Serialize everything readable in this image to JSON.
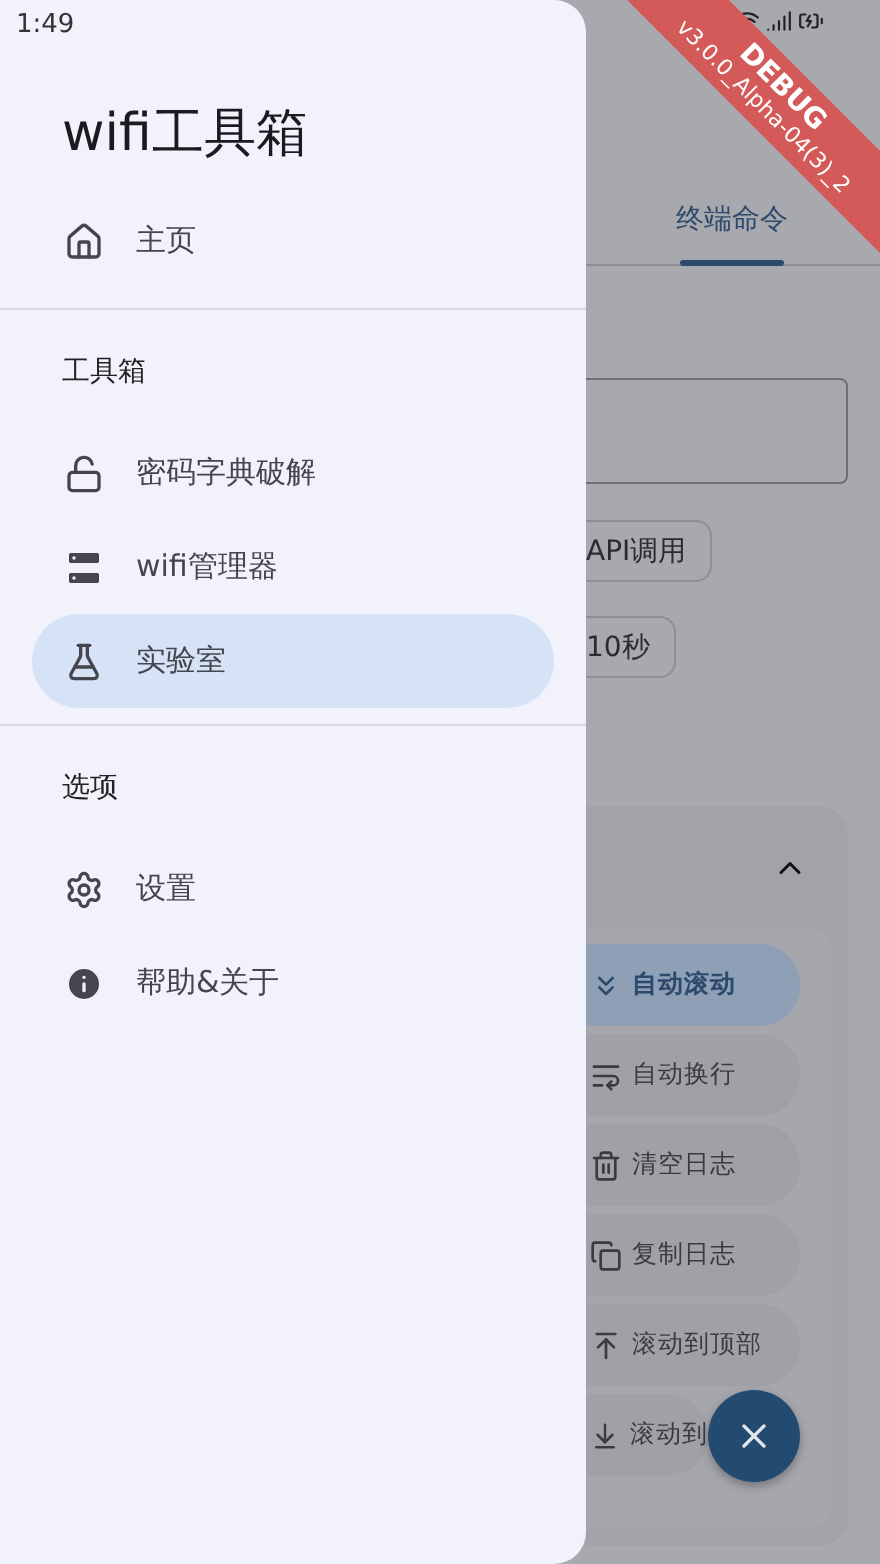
{
  "status_bar": {
    "time": "1:49"
  },
  "debug_banner": {
    "label": "DEBUG",
    "version": "v3.0.0_Alpha-04(3)_2"
  },
  "drawer": {
    "title": "wifi工具箱",
    "sections": [
      {
        "items": [
          {
            "label": "主页",
            "selected": false
          }
        ]
      },
      {
        "heading": "工具箱",
        "items": [
          {
            "label": "密码字典破解",
            "selected": false
          },
          {
            "label": "wifi管理器",
            "selected": false
          },
          {
            "label": "实验室",
            "selected": true
          }
        ]
      },
      {
        "heading": "选项",
        "items": [
          {
            "label": "设置",
            "selected": false
          },
          {
            "label": "帮助&关于",
            "selected": false
          }
        ]
      }
    ]
  },
  "page": {
    "tabs": [
      {
        "label": "终端命令",
        "selected": true
      }
    ],
    "chips": [
      "API调用",
      "10秒"
    ],
    "log_panel": {
      "expanded": true,
      "actions": [
        {
          "label": "自动滚动",
          "selected": true
        },
        {
          "label": "自动换行",
          "selected": false
        },
        {
          "label": "清空日志",
          "selected": false
        },
        {
          "label": "复制日志",
          "selected": false
        },
        {
          "label": "滚动到顶部",
          "selected": false
        },
        {
          "label": "滚动到",
          "selected": false
        }
      ]
    }
  }
}
